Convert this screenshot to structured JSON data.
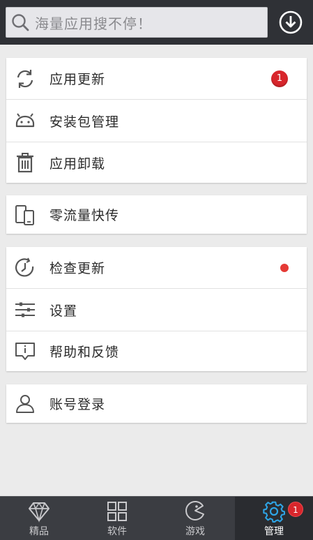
{
  "search": {
    "placeholder": "海量应用搜不停！"
  },
  "header": {
    "download_icon": "download-circle-icon"
  },
  "sections": [
    {
      "items": [
        {
          "label": "应用更新",
          "icon": "refresh-icon",
          "badge": "1"
        },
        {
          "label": "安装包管理",
          "icon": "android-icon"
        },
        {
          "label": "应用卸载",
          "icon": "trash-icon"
        }
      ]
    },
    {
      "items": [
        {
          "label": "零流量快传",
          "icon": "phone-transfer-icon"
        }
      ]
    },
    {
      "items": [
        {
          "label": "检查更新",
          "icon": "check-update-icon",
          "dot": true
        },
        {
          "label": "设置",
          "icon": "sliders-icon"
        },
        {
          "label": "帮助和反馈",
          "icon": "feedback-icon"
        }
      ]
    },
    {
      "items": [
        {
          "label": "账号登录",
          "icon": "user-icon"
        }
      ]
    }
  ],
  "bottom_nav": {
    "tabs": [
      {
        "label": "精品",
        "icon": "diamond-icon"
      },
      {
        "label": "软件",
        "icon": "grid-icon"
      },
      {
        "label": "游戏",
        "icon": "pacman-icon"
      },
      {
        "label": "管理",
        "icon": "gear-icon",
        "badge": "1",
        "active": true
      }
    ]
  },
  "colors": {
    "accent": "#2ea5e6",
    "badge": "#d8262c",
    "header_bg": "#2f3136",
    "page_bg": "#ebebeb"
  }
}
